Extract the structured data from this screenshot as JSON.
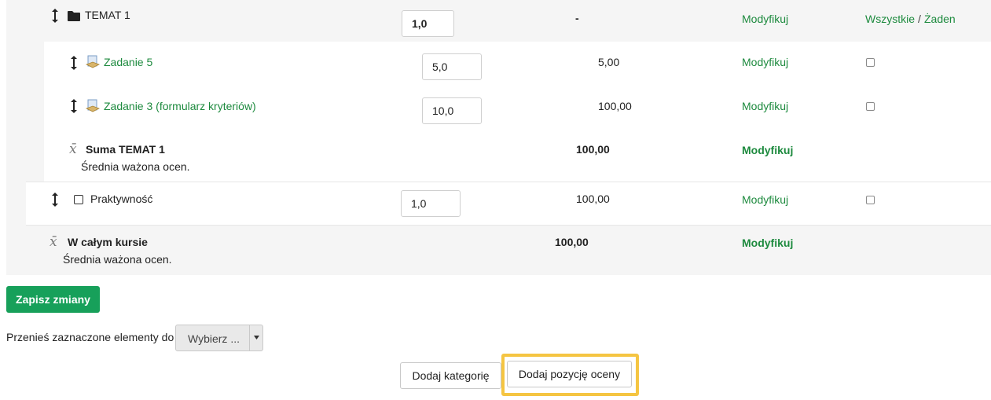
{
  "rows": {
    "category": {
      "name": "TEMAT 1",
      "weight": "1,0",
      "total": "-",
      "action": "Modyfikuj",
      "select_all": "Wszystkie",
      "separator": "/",
      "select_none": "Żaden"
    },
    "item1": {
      "name": "Zadanie 5",
      "weight": "5,0",
      "max": "5,00",
      "action": "Modyfikuj"
    },
    "item2": {
      "name": "Zadanie 3 (formularz kryteriów)",
      "weight": "10,0",
      "max": "100,00",
      "action": "Modyfikuj"
    },
    "cat_total": {
      "name": "Suma TEMAT 1",
      "desc": "Średnia ważona ocen.",
      "max": "100,00",
      "action": "Modyfikuj"
    },
    "item3": {
      "name": "Praktywność",
      "weight": "1,0",
      "max": "100,00",
      "action": "Modyfikuj"
    },
    "course_total": {
      "name": "W całym kursie",
      "desc": "Średnia ważona ocen.",
      "max": "100,00",
      "action": "Modyfikuj"
    }
  },
  "save_button": "Zapisz zmiany",
  "move_label": "Przenieś zaznaczone elementy do",
  "move_select": "Wybierz ...",
  "add_category": "Dodaj kategorię",
  "add_grade_item": "Dodaj pozycję oceny",
  "colors": {
    "green": "#1d8a3e",
    "button_green": "#17a05a",
    "highlight": "#f5c542",
    "row_grey": "#f5f5f5"
  }
}
